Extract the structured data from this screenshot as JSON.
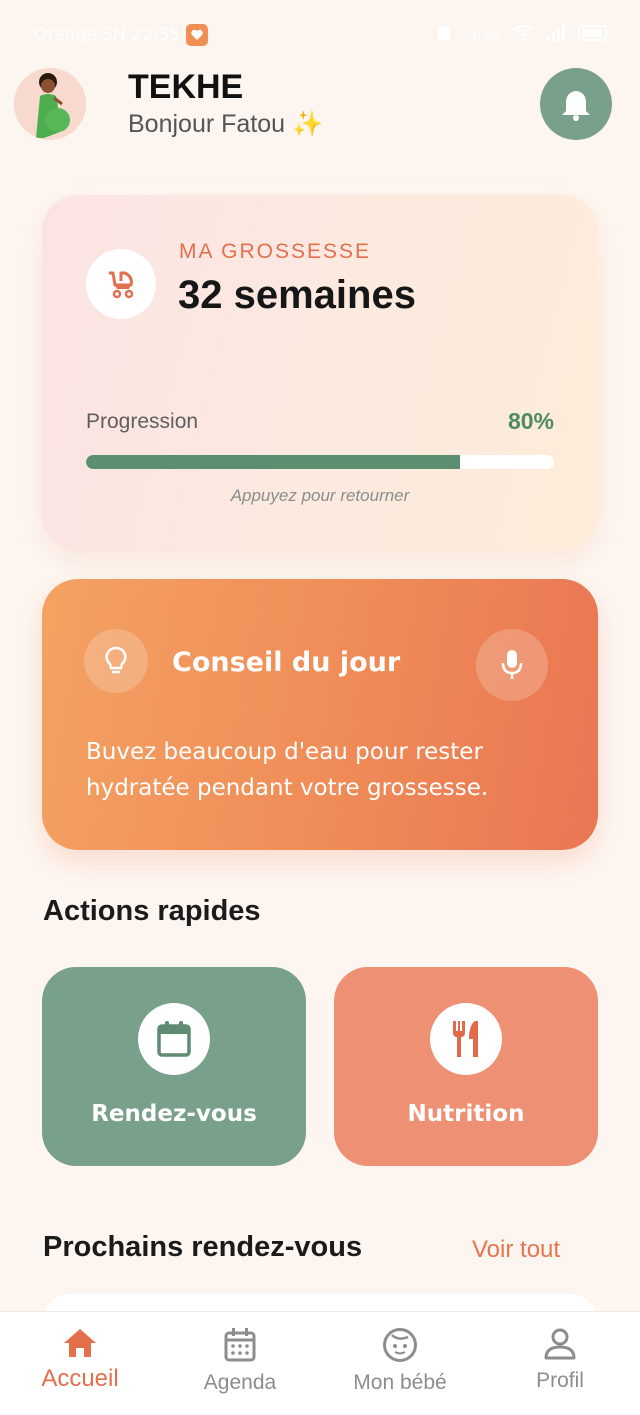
{
  "status_bar": {
    "carrier_time": "Orange SN 22:35",
    "indicators": "5G 4G"
  },
  "header": {
    "app_title": "TEKHE",
    "greeting": "Bonjour Fatou ✨"
  },
  "pregnancy": {
    "label": "MA GROSSESSE",
    "weeks": "32 semaines",
    "progress_label": "Progression",
    "progress_value_text": "80%",
    "progress_fraction": 0.8,
    "hint": "Appuyez pour retourner"
  },
  "tip": {
    "title": "Conseil du jour",
    "text": "Buvez beaucoup d'eau pour rester hydratée pendant votre grossesse."
  },
  "quick_actions": {
    "title": "Actions rapides",
    "items": [
      {
        "label": "Rendez-vous",
        "icon": "calendar-icon",
        "color": "#79a08a"
      },
      {
        "label": "Nutrition",
        "icon": "utensils-icon",
        "color": "#ed9073"
      }
    ]
  },
  "appointments": {
    "title": "Prochains rendez-vous",
    "see_all": "Voir tout"
  },
  "bottom_nav": {
    "items": [
      {
        "label": "Accueil",
        "icon": "home-icon",
        "active": true
      },
      {
        "label": "Agenda",
        "icon": "calendar-icon",
        "active": false
      },
      {
        "label": "Mon bébé",
        "icon": "baby-face-icon",
        "active": false
      },
      {
        "label": "Profil",
        "icon": "user-icon",
        "active": false
      }
    ]
  },
  "colors": {
    "accent": "#e36f4d",
    "green": "#5b8f70",
    "background": "#fdf5ef"
  }
}
